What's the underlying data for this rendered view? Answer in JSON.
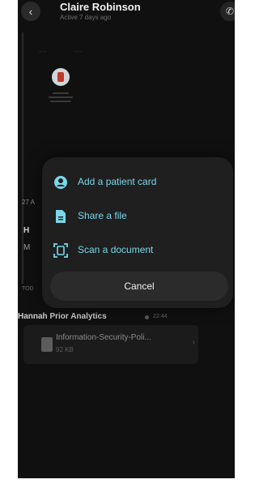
{
  "header": {
    "back_icon": "chevron-left-icon",
    "contact_name": "Claire Robinson",
    "status": "Active 7 days ago",
    "call_icon": "phone-icon"
  },
  "background_chat": {
    "date_label": "27 A",
    "sender_initial": "H",
    "message_initial": "M",
    "today_label": "TOD"
  },
  "file_message": {
    "sender": "Hannah Prior Analytics",
    "time": "22:44",
    "file_name": "Information-Security-Poli...",
    "file_size": "92 KB",
    "file_icon": "document-icon"
  },
  "action_sheet": {
    "items": [
      {
        "label": "Add a patient card",
        "icon": "person-circle-icon"
      },
      {
        "label": "Share a file",
        "icon": "file-icon"
      },
      {
        "label": "Scan a document",
        "icon": "scan-icon"
      }
    ],
    "cancel_label": "Cancel"
  },
  "colors": {
    "accent": "#7ad7ea",
    "background": "#101010",
    "sheet": "#1f1f1f"
  }
}
